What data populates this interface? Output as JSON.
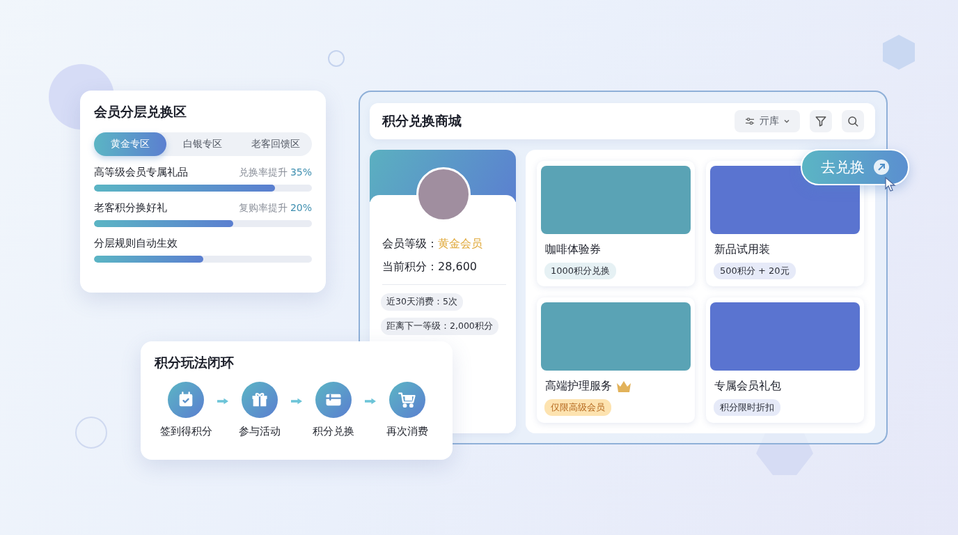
{
  "tier_panel": {
    "title": "会员分层兑换区",
    "tabs": [
      {
        "label": "黄金专区",
        "selected": true
      },
      {
        "label": "白银专区",
        "selected": false
      },
      {
        "label": "老客回馈区",
        "selected": false
      }
    ],
    "metrics": [
      {
        "label": "高等级会员专属礼品",
        "note": "兑换率提升",
        "rate": "35%",
        "level": 0.83
      },
      {
        "label": "老客积分换好礼",
        "note": "复购率提升",
        "rate": "20%",
        "level": 0.64
      },
      {
        "label": "分层规则自动生效",
        "level": 0.5
      }
    ]
  },
  "store": {
    "title": "积分兑换商城",
    "sort_label": "亓库",
    "member": {
      "level_label": "会员等级：",
      "level": "黄金会员",
      "points_label": "当前积分：",
      "points": "28,600",
      "chips": [
        "近30天消费：5次",
        "距离下一等级：2,000积分"
      ]
    },
    "products": [
      {
        "name": "咖啡体验券",
        "tag": "1000积分兑换",
        "color": "#5aa3b5",
        "premium": false
      },
      {
        "name": "新品试用装",
        "tag": "500积分 + 20元",
        "color": "#5a74d0",
        "premium": false
      },
      {
        "name": "高端护理服务",
        "tag": "仅限高级会员",
        "color": "#5aa3b5",
        "premium": true
      },
      {
        "name": "专属会员礼包",
        "tag": "积分限时折扣",
        "color": "#5a74d0",
        "premium": false
      }
    ]
  },
  "redeem_button": {
    "label": "去兑换"
  },
  "loop_panel": {
    "title": "积分玩法闭环",
    "steps": [
      {
        "label": "签到得积分",
        "kind": "calendar"
      },
      {
        "label": "参与活动",
        "kind": "gift"
      },
      {
        "label": "积分兑换",
        "kind": "card"
      },
      {
        "label": "再次消费",
        "kind": "cart"
      }
    ]
  }
}
